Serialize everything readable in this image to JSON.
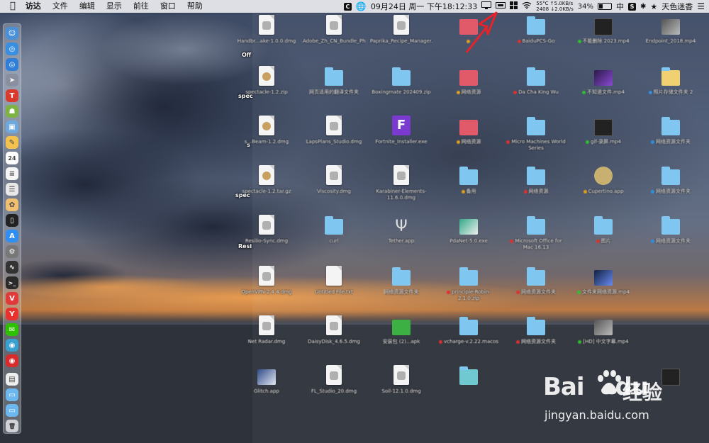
{
  "menubar": {
    "app_name": "访达",
    "menus": [
      "文件",
      "编辑",
      "显示",
      "前往",
      "窗口",
      "帮助"
    ],
    "status": {
      "date_time": "09月24日 周一 下午18:12:33",
      "temp": "55°C",
      "fan": "2408",
      "net_up": "↑5.0KB/s",
      "net_down": "↓2.0KB/s",
      "battery": "34%",
      "battery_level": 0.34,
      "input_method": "中",
      "user_name": "天色迷香",
      "s_label": "S",
      "c_label": "C"
    }
  },
  "sharp_labels": {
    "l1": "Off",
    "l2": "spec",
    "l3": "s",
    "l4": "spec",
    "l5": "Resi"
  },
  "desktop": {
    "items": [
      {
        "label": "Handbr...ake-1.0.0.dmg",
        "kind": "doc"
      },
      {
        "label": "Adobe_Zh_CN_Bundle_Photoshop.dmg",
        "kind": "doc"
      },
      {
        "label": "Paprika_Recipe_Manager.dmg",
        "kind": "doc"
      },
      {
        "label": "",
        "kind": "red",
        "dot": "#e0a020"
      },
      {
        "label": "BaiduPCS-Go",
        "kind": "folder",
        "dot": "#e03030"
      },
      {
        "label": "不能删除 2023.mp4",
        "kind": "dark",
        "dot": "#30c030"
      },
      {
        "label": "Endpoint_2018.mp4",
        "kind": "photo"
      },
      {
        "label": "spectacle-1.2.zip",
        "kind": "pkg"
      },
      {
        "label": "网页适用的翻译文件夹",
        "kind": "folder"
      },
      {
        "label": "Boxingmate 202409.zip",
        "kind": "folder"
      },
      {
        "label": "网络资源",
        "kind": "red",
        "dot": "#e0a020"
      },
      {
        "label": "Da Cha King Wu",
        "kind": "folder",
        "dot": "#e03030"
      },
      {
        "label": "不知道文件.mp4",
        "kind": "purple",
        "dot": "#30c030"
      },
      {
        "label": "照片存储文件夹 2",
        "kind": "yellow",
        "dot": "#3090e0"
      },
      {
        "label": "s...Beam-1.2.dmg",
        "kind": "pkg"
      },
      {
        "label": "LapsPlans_Studio.dmg",
        "kind": "doc"
      },
      {
        "label": "Fortnite_Installer.exe",
        "kind": "fortnite"
      },
      {
        "label": "网络资源",
        "kind": "red",
        "dot": "#e0a020"
      },
      {
        "label": "Micro Machines World Series",
        "kind": "folder",
        "dot": "#e03030"
      },
      {
        "label": "gif-录屏.mp4",
        "kind": "dark",
        "dot": "#30c030"
      },
      {
        "label": "网络资源文件夹",
        "kind": "folder",
        "dot": "#3090e0"
      },
      {
        "label": "spectacle-1.2.tar.gz",
        "kind": "pkg"
      },
      {
        "label": "Viscosity.dmg",
        "kind": "doc"
      },
      {
        "label": "Karabiner-Elements-11.6.0.dmg",
        "kind": "doc"
      },
      {
        "label": "备用",
        "kind": "folder",
        "dot": "#e0a020"
      },
      {
        "label": "网络资源",
        "kind": "folder",
        "dot": "#e03030"
      },
      {
        "label": "Cupertino.app",
        "kind": "round",
        "dot": "#e0a020"
      },
      {
        "label": "网络资源文件夹",
        "kind": "folder",
        "dot": "#3090e0"
      },
      {
        "label": "Resilio-Sync.dmg",
        "kind": "doc"
      },
      {
        "label": "curl",
        "kind": "folder"
      },
      {
        "label": "Tether.app",
        "kind": "usb"
      },
      {
        "label": "PdaNet-5.0.exe",
        "kind": "mixed"
      },
      {
        "label": "Microsoft Office for Mac 16.13",
        "kind": "folder",
        "dot": "#e03030"
      },
      {
        "label": "图片",
        "kind": "folder",
        "dot": "#e03030"
      },
      {
        "label": "网络资源文件夹",
        "kind": "folder",
        "dot": "#3090e0"
      },
      {
        "label": "OpenVPN-2.4.4.dmg",
        "kind": "doc"
      },
      {
        "label": "Untitled File.txt",
        "kind": "blank"
      },
      {
        "label": "网络资源文件夹",
        "kind": "folder"
      },
      {
        "label": "principle-Robin-2.1.0.zip",
        "kind": "folder",
        "dot": "#e03030"
      },
      {
        "label": "网络资源文件夹",
        "kind": "folder",
        "dot": "#e03030"
      },
      {
        "label": "文件夹网络资源.mp4",
        "kind": "spark",
        "dot": "#30c030"
      },
      {
        "label": "",
        "kind": "none"
      },
      {
        "label": "Net Radar.dmg",
        "kind": "doc"
      },
      {
        "label": "DaisyDisk_4.6.5.dmg",
        "kind": "doc"
      },
      {
        "label": "安装包 (2)...apk",
        "kind": "green"
      },
      {
        "label": "vcharge-v.2.22.macos",
        "kind": "folder",
        "dot": "#e03030"
      },
      {
        "label": "网络资源文件夹",
        "kind": "folder",
        "dot": "#e03030"
      },
      {
        "label": "[HD] 中文字幕.mp4",
        "kind": "photo",
        "dot": "#30c030"
      },
      {
        "label": "",
        "kind": "none"
      },
      {
        "label": "Glitch.app",
        "kind": "app"
      },
      {
        "label": "FL_Studio_20.dmg",
        "kind": "doc"
      },
      {
        "label": "Soil-12.1.0.dmg",
        "kind": "doc"
      },
      {
        "label": "",
        "kind": "teal"
      },
      {
        "label": "",
        "kind": "none"
      },
      {
        "label": "",
        "kind": "none"
      },
      {
        "label": "",
        "kind": "dark"
      }
    ]
  },
  "watermark": {
    "brand": "Bai",
    "brand2": "du",
    "cn": "经验",
    "url": "jingyan.baidu.com"
  },
  "dock": {
    "icons": [
      "finder-icon",
      "safari-icon",
      "safari-alt-icon",
      "launchpad-icon",
      "app-red-icon",
      "android-icon",
      "preview-icon",
      "notes-icon",
      "calendar-icon",
      "document-icon",
      "list-icon",
      "photos-icon",
      "terminal-icon",
      "app-store-icon",
      "system-preferences-icon",
      "activity-monitor-icon",
      "console-icon",
      "vivaldi-icon",
      "yandex-icon",
      "wechat-icon",
      "browser-icon",
      "netease-icon",
      "file-icon",
      "folder-icon",
      "folder2-icon",
      "trash-icon"
    ]
  }
}
